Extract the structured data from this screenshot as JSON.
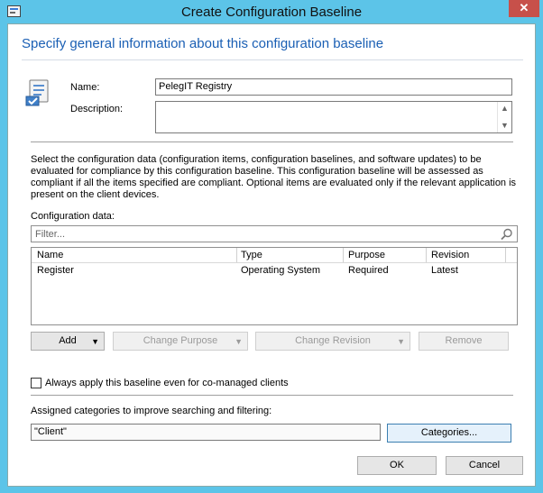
{
  "window": {
    "title": "Create Configuration Baseline",
    "close_glyph": "✕"
  },
  "page": {
    "heading": "Specify general information about this configuration baseline"
  },
  "form": {
    "name_label": "Name:",
    "name_value": "PelegIT Registry",
    "description_label": "Description:",
    "description_value": ""
  },
  "info_text": "Select the configuration data (configuration items, configuration baselines, and software updates) to be evaluated for compliance by this configuration baseline. This configuration baseline will be assessed as compliant if all the items specified are compliant. Optional items are evaluated only if the relevant application is present on  the client devices.",
  "config_data": {
    "label": "Configuration data:",
    "filter_placeholder": "Filter...",
    "columns": [
      "Name",
      "Type",
      "Purpose",
      "Revision"
    ],
    "rows": [
      [
        "Register",
        "Operating System",
        "Required",
        "Latest"
      ]
    ]
  },
  "actions": {
    "add": "Add",
    "change_purpose": "Change Purpose",
    "change_revision": "Change Revision",
    "remove": "Remove",
    "dropdown_glyph": "▼"
  },
  "comanaged": {
    "label": "Always apply this baseline even for co-managed clients",
    "checked": false
  },
  "categories": {
    "label": "Assigned categories to improve searching and filtering:",
    "value": "\"Client\"",
    "button": "Categories..."
  },
  "footer": {
    "ok": "OK",
    "cancel": "Cancel"
  },
  "icons": [
    "app-icon",
    "close-icon",
    "baseline-icon",
    "search-icon",
    "scroll-up-icon",
    "scroll-down-icon",
    "dropdown-arrow-icon"
  ],
  "colors": {
    "title_bar": "#5cc4e8",
    "heading": "#1a5fb4",
    "close": "#c7504a"
  }
}
